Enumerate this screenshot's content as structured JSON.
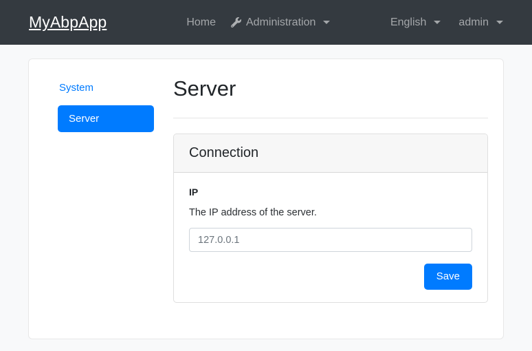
{
  "navbar": {
    "brand": "MyAbpApp",
    "left_items": [
      {
        "label": "Home",
        "icon": "",
        "has_caret": false
      },
      {
        "label": "Administration",
        "icon": "wrench-icon",
        "has_caret": true
      }
    ],
    "right_items": [
      {
        "label": "English",
        "has_caret": true
      },
      {
        "label": "admin",
        "has_caret": true
      }
    ]
  },
  "sidebar": {
    "group_label": "System",
    "items": [
      {
        "label": "Server",
        "active": true
      }
    ]
  },
  "main": {
    "title": "Server",
    "card": {
      "header": "Connection",
      "field": {
        "label": "IP",
        "description": "The IP address of the server.",
        "value": "",
        "placeholder": "127.0.0.1"
      },
      "save_label": "Save"
    }
  },
  "colors": {
    "navbar_bg": "#343a40",
    "primary": "#007bff",
    "page_bg": "#f8f9fa",
    "card_header_bg": "#f7f7f7",
    "link": "#007bff"
  }
}
